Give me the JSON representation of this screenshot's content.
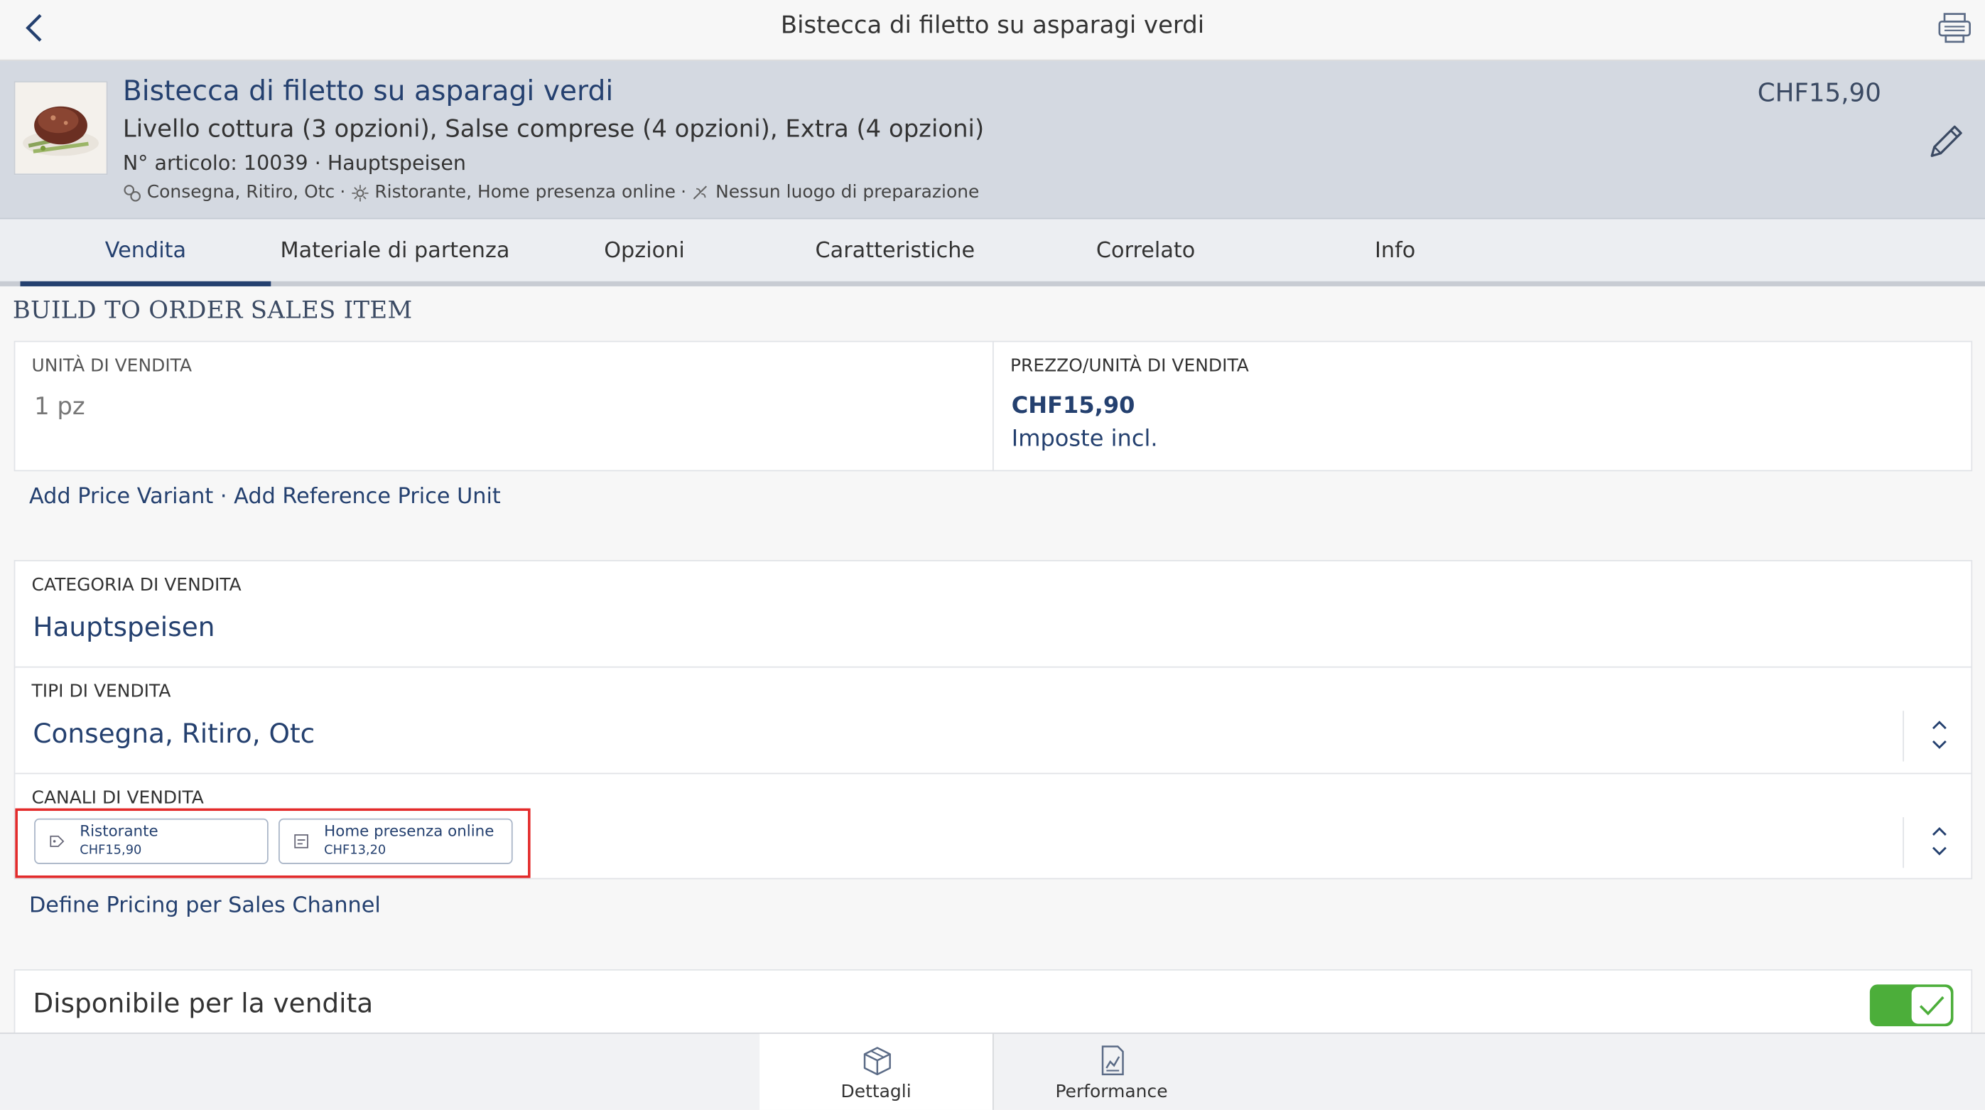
{
  "topbar": {
    "title": "Bistecca di filetto su asparagi verdi",
    "back_icon": "chevron-left-icon",
    "printer_icon": "printer-icon"
  },
  "item": {
    "name": "Bistecca di filetto su asparagi verdi",
    "description": "Livello cottura (3 opzioni), Salse comprese (4 opzioni), Extra (4 opzioni)",
    "meta": "N° articolo: 10039 · Hauptspeisen",
    "sales_types": "Consegna, Ritiro, Otc",
    "sep1": " · ",
    "channels": "Ristorante, Home presenza online",
    "sep2": " · ",
    "prep": "Nessun luogo di preparazione",
    "price": "CHF15,90"
  },
  "tabs": [
    {
      "label": "Vendita",
      "active": true
    },
    {
      "label": "Materiale di partenza"
    },
    {
      "label": "Opzioni"
    },
    {
      "label": "Caratteristiche"
    },
    {
      "label": "Correlato"
    },
    {
      "label": "Info"
    }
  ],
  "section_title": "BUILD TO ORDER SALES ITEM",
  "unit": {
    "label": "UNITÀ DI VENDITA",
    "value": "1 pz"
  },
  "price_field": {
    "label": "PREZZO/UNITÀ DI VENDITA",
    "value": "CHF15,90",
    "note": "Imposte incl."
  },
  "links": {
    "add_price_variant": "Add Price Variant",
    "dot": " · ",
    "add_reference_price_unit": "Add Reference Price Unit",
    "define_pricing": "Define Pricing per Sales Channel"
  },
  "category": {
    "label": "CATEGORIA DI VENDITA",
    "value": "Hauptspeisen"
  },
  "sales_types_field": {
    "label": "TIPI DI VENDITA",
    "value": "Consegna, Ritiro, Otc"
  },
  "channels_field": {
    "label": "CANALI DI VENDITA",
    "chips": [
      {
        "name": "Ristorante",
        "price": "CHF15,90"
      },
      {
        "name": "Home presenza online",
        "price": "CHF13,20"
      }
    ]
  },
  "available": {
    "label": "Disponibile per la vendita",
    "checked": true
  },
  "bottom_tabs": [
    {
      "label": "Dettagli",
      "icon": "box-icon",
      "active": true
    },
    {
      "label": "Performance",
      "icon": "chart-icon"
    }
  ],
  "colors": {
    "accent": "#24406f",
    "header_bg": "#d4d9e1",
    "toggle": "#4cae3a",
    "highlight": "#e32b2b"
  }
}
